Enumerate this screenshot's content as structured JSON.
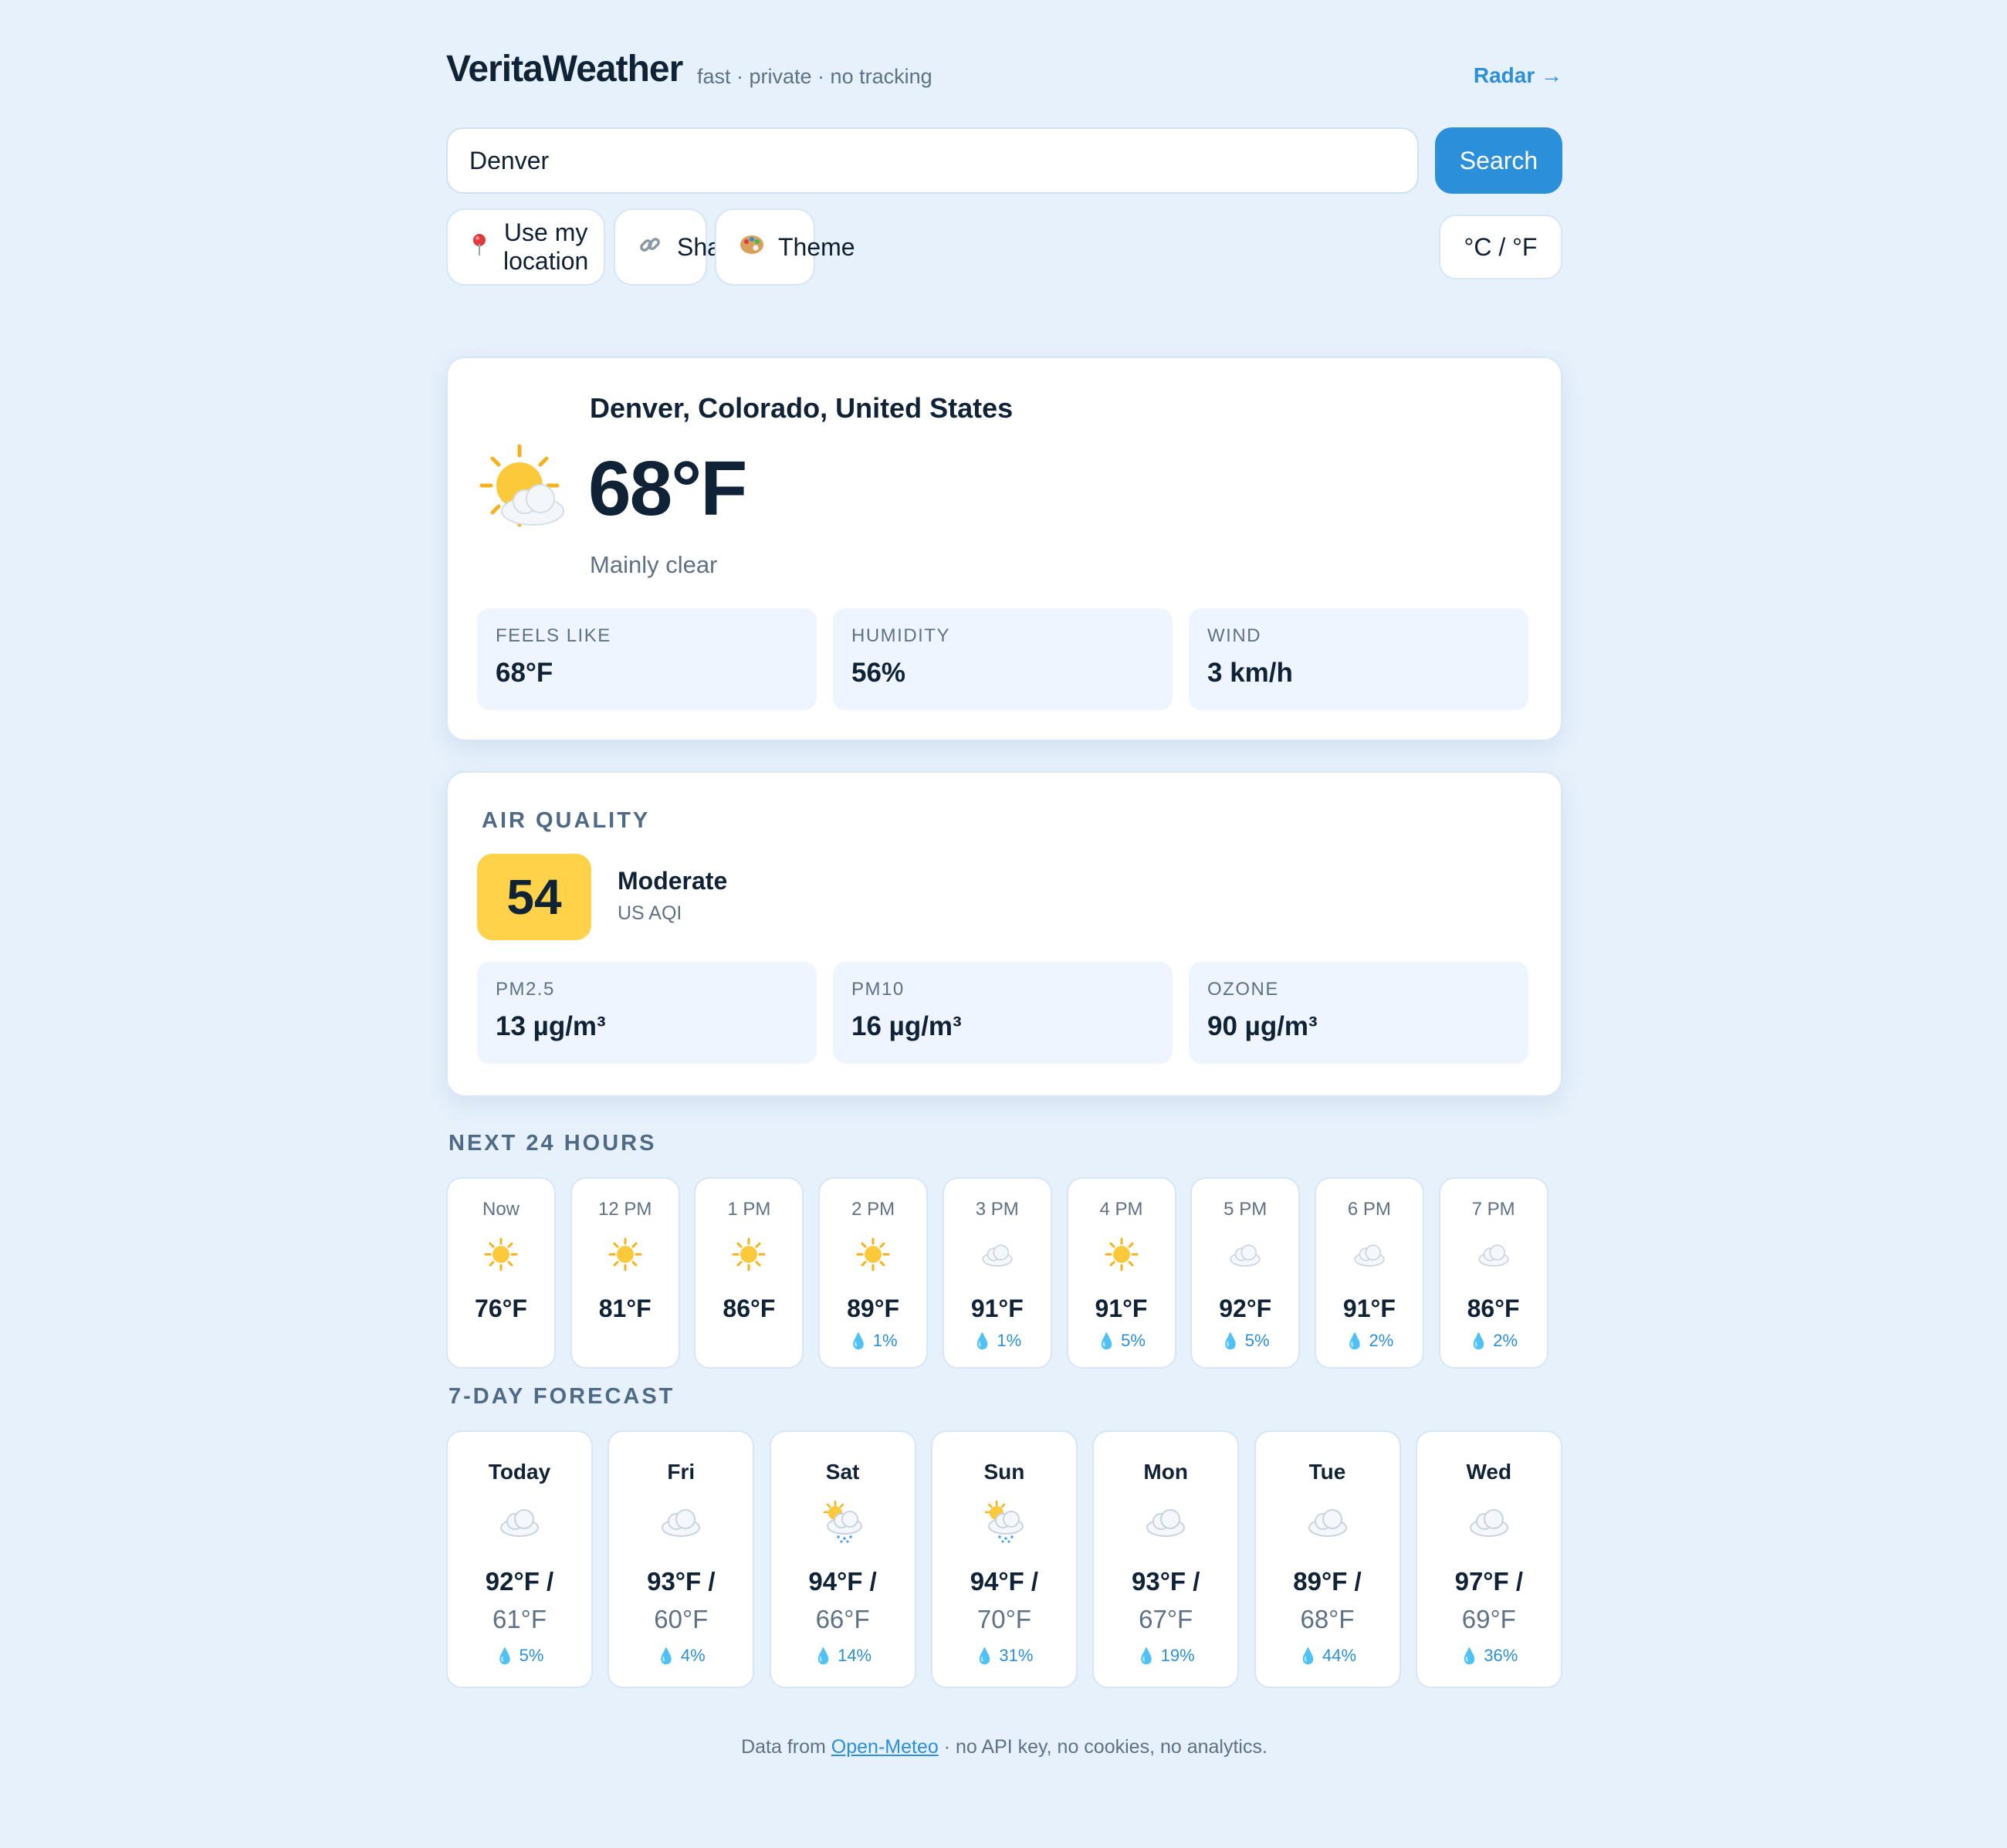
{
  "header": {
    "brand": "VeritaWeather",
    "tagline": "fast · private · no tracking",
    "radar_link": "Radar →"
  },
  "search": {
    "value": "Denver",
    "button": "Search"
  },
  "actions": {
    "location": "Use my location",
    "share": "Share",
    "theme": "Theme",
    "units": "°C / °F"
  },
  "current": {
    "location": "Denver, Colorado, United States",
    "temp": "68°F",
    "condition": "Mainly clear",
    "icon": "sun-behind-cloud-icon",
    "stats": [
      {
        "label": "FEELS LIKE",
        "value": "68°F"
      },
      {
        "label": "HUMIDITY",
        "value": "56%"
      },
      {
        "label": "WIND",
        "value": "3 km/h"
      }
    ]
  },
  "air": {
    "title": "AIR QUALITY",
    "aqi": "54",
    "category": "Moderate",
    "scale": "US AQI",
    "aqi_color": "#ffd24a",
    "stats": [
      {
        "label": "PM2.5",
        "value": "13 µg/m³"
      },
      {
        "label": "PM10",
        "value": "16 µg/m³"
      },
      {
        "label": "OZONE",
        "value": "90 µg/m³"
      }
    ]
  },
  "hourly": {
    "title": "NEXT 24 HOURS",
    "items": [
      {
        "time": "Now",
        "icon": "sun-icon",
        "temp": "76°F",
        "precip": ""
      },
      {
        "time": "12 PM",
        "icon": "sun-icon",
        "temp": "81°F",
        "precip": ""
      },
      {
        "time": "1 PM",
        "icon": "sun-icon",
        "temp": "86°F",
        "precip": ""
      },
      {
        "time": "2 PM",
        "icon": "sun-icon",
        "temp": "89°F",
        "precip": "1%"
      },
      {
        "time": "3 PM",
        "icon": "cloud-icon",
        "temp": "91°F",
        "precip": "1%"
      },
      {
        "time": "4 PM",
        "icon": "sun-icon",
        "temp": "91°F",
        "precip": "5%"
      },
      {
        "time": "5 PM",
        "icon": "cloud-icon",
        "temp": "92°F",
        "precip": "5%"
      },
      {
        "time": "6 PM",
        "icon": "cloud-icon",
        "temp": "91°F",
        "precip": "2%"
      },
      {
        "time": "7 PM",
        "icon": "cloud-icon",
        "temp": "86°F",
        "precip": "2%"
      }
    ]
  },
  "daily": {
    "title": "7-DAY FORECAST",
    "items": [
      {
        "day": "Today",
        "icon": "cloud-icon",
        "high": "92°F /",
        "low": "61°F",
        "precip": "5%"
      },
      {
        "day": "Fri",
        "icon": "cloud-icon",
        "high": "93°F /",
        "low": "60°F",
        "precip": "4%"
      },
      {
        "day": "Sat",
        "icon": "sun-rain-cloud-icon",
        "high": "94°F /",
        "low": "66°F",
        "precip": "14%"
      },
      {
        "day": "Sun",
        "icon": "sun-rain-cloud-icon",
        "high": "94°F /",
        "low": "70°F",
        "precip": "31%"
      },
      {
        "day": "Mon",
        "icon": "cloud-icon",
        "high": "93°F /",
        "low": "67°F",
        "precip": "19%"
      },
      {
        "day": "Tue",
        "icon": "cloud-icon",
        "high": "89°F /",
        "low": "68°F",
        "precip": "44%"
      },
      {
        "day": "Wed",
        "icon": "cloud-icon",
        "high": "97°F /",
        "low": "69°F",
        "precip": "36%"
      }
    ]
  },
  "footer": {
    "prefix": "Data from",
    "link": "Open-Meteo",
    "suffix": "· no API key, no cookies, no analytics."
  },
  "colors": {
    "accent": "#2b8fd9",
    "background": "#e7f1fc",
    "aqi_moderate": "#ffd24a"
  }
}
